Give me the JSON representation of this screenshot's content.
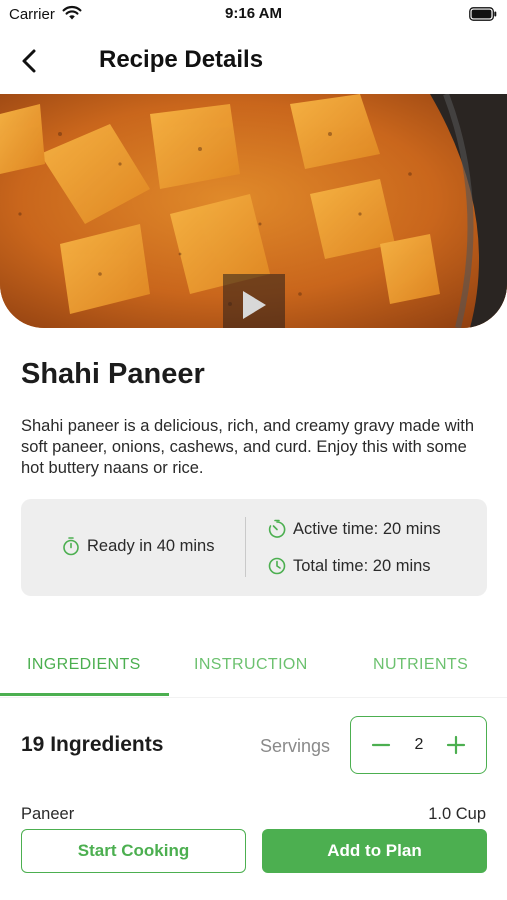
{
  "status_bar": {
    "carrier": "Carrier",
    "time": "9:16 AM"
  },
  "nav": {
    "title": "Recipe Details"
  },
  "recipe": {
    "title": "Shahi Paneer",
    "description": "Shahi paneer is a delicious, rich, and creamy gravy made with soft paneer, onions, cashews, and curd. Enjoy this with some hot buttery naans or rice."
  },
  "times": {
    "ready": "Ready in 40 mins",
    "active": "Active time: 20 mins",
    "total": "Total time: 20 mins"
  },
  "tabs": [
    {
      "label": "INGREDIENTS",
      "active": true
    },
    {
      "label": "INSTRUCTION",
      "active": false
    },
    {
      "label": "NUTRIENTS",
      "active": false
    }
  ],
  "ingredients": {
    "count_label": "19 Ingredients",
    "servings_label": "Servings",
    "servings_value": "2",
    "items": [
      {
        "name": "Paneer",
        "quantity": "1.0 Cup"
      }
    ]
  },
  "actions": {
    "start_cooking": "Start Cooking",
    "add_to_plan": "Add to Plan"
  },
  "icons": {
    "back": "chevron-left-icon",
    "play": "play-icon",
    "ready": "stopwatch-icon",
    "active": "timer-icon",
    "total": "clock-icon",
    "minus": "minus-icon",
    "plus": "plus-icon"
  },
  "colors": {
    "accent": "#4caf50",
    "card_bg": "#eeeeee"
  }
}
